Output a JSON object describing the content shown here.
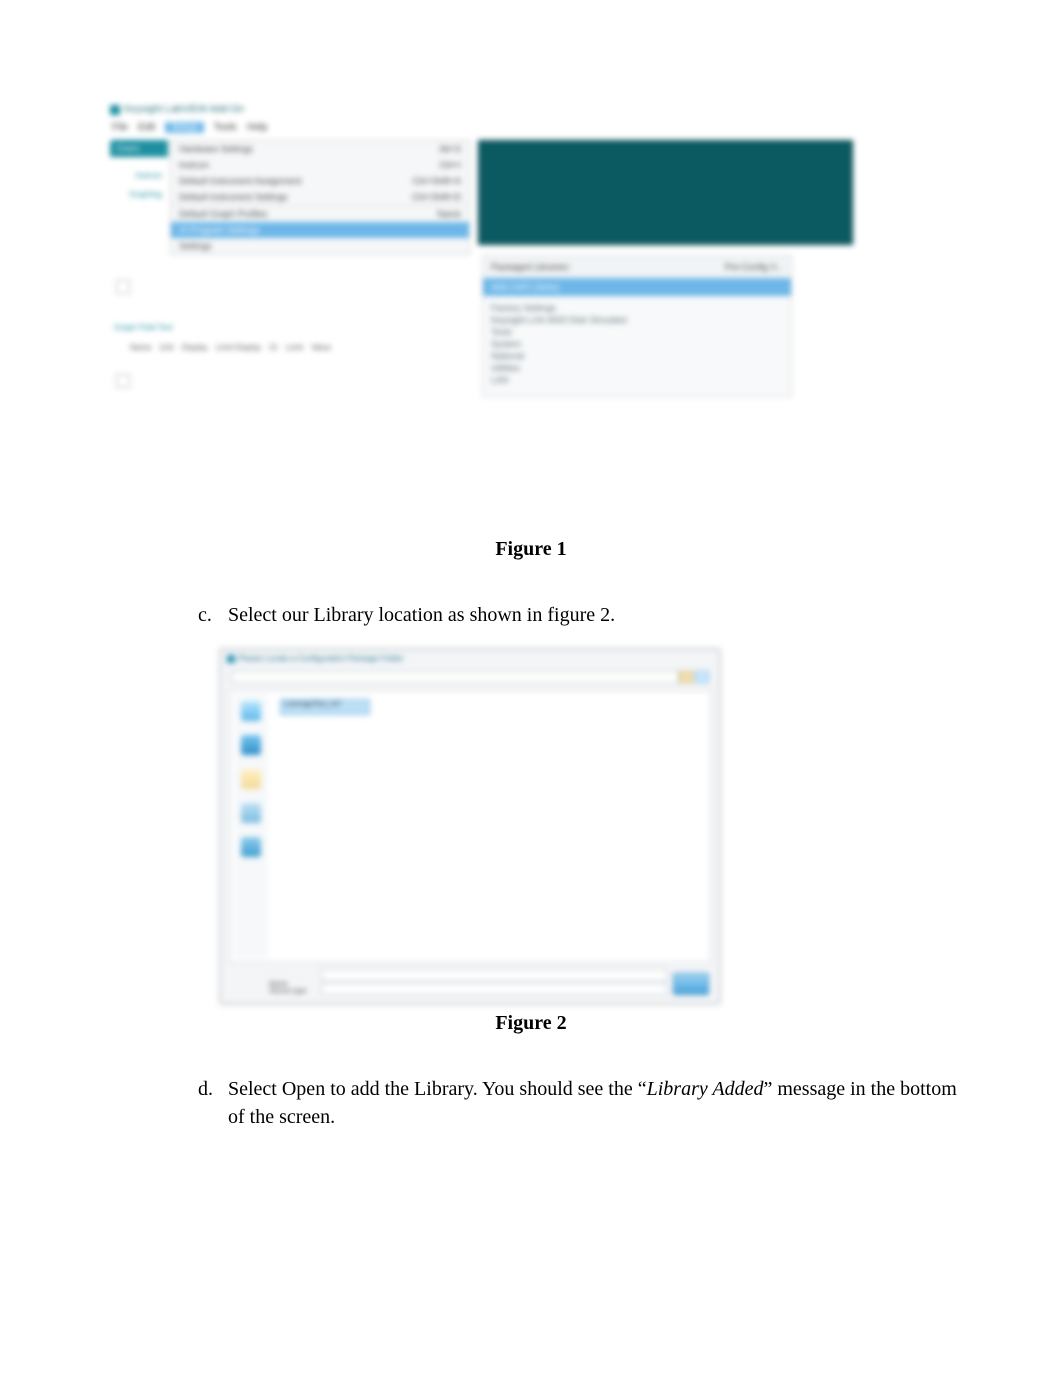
{
  "figure1": {
    "caption": "Figure 1",
    "app_title": "Keysight LabVIEW Add-On",
    "menubar": [
      "File",
      "Edit",
      "Setup",
      "Tools",
      "Help"
    ],
    "sidebar": {
      "active": "Chann",
      "tab2": "Instrum",
      "tab3": "Graphing"
    },
    "left_label": "Graph Field Text",
    "dropdown": {
      "rows": [
        {
          "left": "Hardware Settings",
          "right": "Alt+S"
        },
        {
          "left": "Instrum",
          "right": "Ctrl+I"
        },
        {
          "left": "Default Instrument Assignment",
          "right": "Ctrl+Shift+A"
        },
        {
          "left": "Default Instrument Settings",
          "right": "Ctrl+Shift+D"
        }
      ],
      "separator_row": {
        "left": "Default Graph Profiles",
        "right": "Name"
      },
      "highlight_row": {
        "left": "VI Program Settings",
        "right": ""
      },
      "final_row": {
        "left": "Settings",
        "right": ""
      }
    },
    "grid_headers": [
      "Name",
      "Unit",
      "Display",
      "Limit Display",
      "Or",
      "Limit",
      "Value"
    ],
    "right_panel": {
      "header_left": "Packaged Libraries:",
      "header_right": "Pre-Config V...",
      "selected": "Add LNXI Library",
      "list": [
        "Factory Settings",
        "Keysight LXA 4500 Disk Simulator",
        "Toolz",
        "System",
        "National",
        "Utilities",
        "LAN"
      ]
    }
  },
  "step_c": {
    "marker": "c.",
    "text": "Select our Library location as shown in figure 2."
  },
  "figure2": {
    "caption": "Figure 2",
    "dialog_title": "Please Locate a Configuration Package Folder",
    "folder_name": "LaverageText_v07",
    "bottom_label1": "Name",
    "bottom_label2": "Source type",
    "open_button": "Open"
  },
  "step_d": {
    "marker": "d.",
    "prefix": "Select Open to add the Library. You should see the “",
    "italic": "Library Added",
    "suffix": "” message in the bottom of the screen."
  }
}
